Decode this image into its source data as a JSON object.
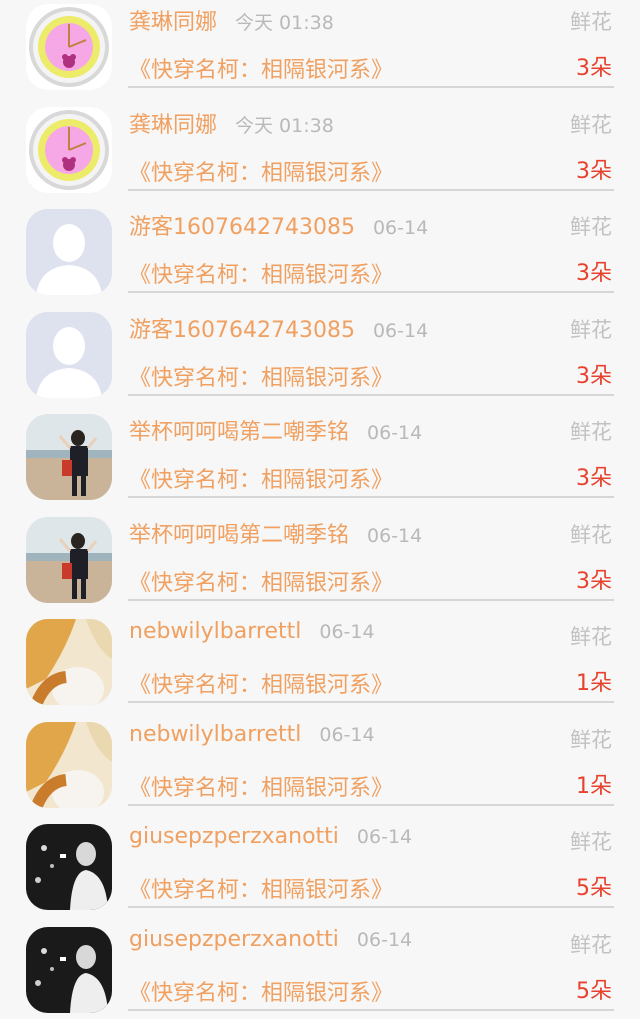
{
  "gifts": [
    {
      "name": "龚琳同娜",
      "time": "今天 01:38",
      "type": "鲜花",
      "book": "《快穿名柯：相隔银河系》",
      "count": "3朵",
      "avatar": "clock-avatar-icon"
    },
    {
      "name": "龚琳同娜",
      "time": "今天 01:38",
      "type": "鲜花",
      "book": "《快穿名柯：相隔银河系》",
      "count": "3朵",
      "avatar": "clock-avatar-icon"
    },
    {
      "name": "游客1607642743085",
      "time": "06-14",
      "type": "鲜花",
      "book": "《快穿名柯：相隔银河系》",
      "count": "3朵",
      "avatar": "default-user-icon"
    },
    {
      "name": "游客1607642743085",
      "time": "06-14",
      "type": "鲜花",
      "book": "《快穿名柯：相隔银河系》",
      "count": "3朵",
      "avatar": "default-user-icon"
    },
    {
      "name": "举杯呵呵喝第二嘲季铭",
      "time": "06-14",
      "type": "鲜花",
      "book": "《快穿名柯：相隔银河系》",
      "count": "3朵",
      "avatar": "beach-photo-avatar"
    },
    {
      "name": "举杯呵呵喝第二嘲季铭",
      "time": "06-14",
      "type": "鲜花",
      "book": "《快穿名柯：相隔银河系》",
      "count": "3朵",
      "avatar": "beach-photo-avatar"
    },
    {
      "name": "nebwilylbarrettl",
      "time": "06-14",
      "type": "鲜花",
      "book": "《快穿名柯：相隔银河系》",
      "count": "1朵",
      "avatar": "blonde-photo-avatar"
    },
    {
      "name": "nebwilylbarrettl",
      "time": "06-14",
      "type": "鲜花",
      "book": "《快穿名柯：相隔银河系》",
      "count": "1朵",
      "avatar": "blonde-photo-avatar"
    },
    {
      "name": "giusepzperzxanotti",
      "time": "06-14",
      "type": "鲜花",
      "book": "《快穿名柯：相隔银河系》",
      "count": "5朵",
      "avatar": "night-photo-avatar"
    },
    {
      "name": "giusepzperzxanotti",
      "time": "06-14",
      "type": "鲜花",
      "book": "《快穿名柯：相隔银河系》",
      "count": "5朵",
      "avatar": "night-photo-avatar"
    }
  ],
  "colors": {
    "name": "#f0a060",
    "time": "#b9b9b9",
    "count": "#e8412e",
    "background": "#f7f7f7"
  }
}
